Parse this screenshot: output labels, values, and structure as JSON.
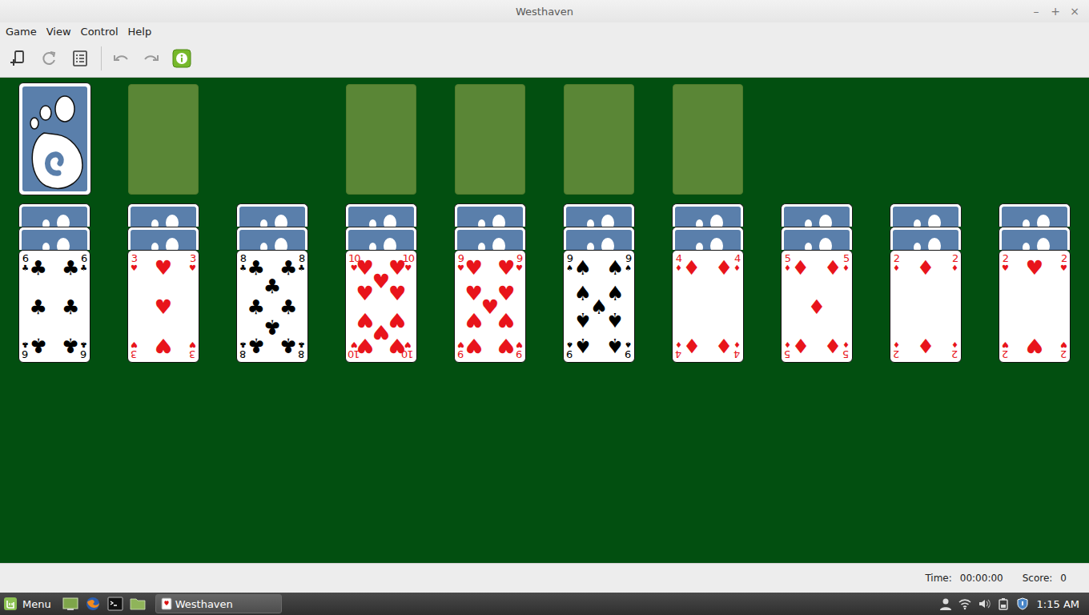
{
  "window": {
    "title": "Westhaven",
    "controls": [
      "–",
      "+",
      "×"
    ]
  },
  "menu": [
    "Game",
    "View",
    "Control",
    "Help"
  ],
  "toolbar": {
    "groups": [
      [
        {
          "kind": "new",
          "disabled": false
        },
        {
          "kind": "restart",
          "disabled": true
        },
        {
          "kind": "stats",
          "disabled": false
        }
      ],
      [
        {
          "kind": "undo",
          "disabled": true
        },
        {
          "kind": "redo",
          "disabled": true
        },
        {
          "kind": "hint",
          "disabled": false
        }
      ]
    ]
  },
  "top_row": [
    {
      "kind": "stock"
    },
    {
      "kind": "slot"
    },
    {
      "kind": "blank"
    },
    {
      "kind": "slot"
    },
    {
      "kind": "slot"
    },
    {
      "kind": "slot"
    },
    {
      "kind": "slot"
    }
  ],
  "tableau": [
    {
      "face_down": 2,
      "card": {
        "rank": "6",
        "suit": "♣",
        "color": "#000000"
      }
    },
    {
      "face_down": 2,
      "card": {
        "rank": "3",
        "suit": "♥",
        "color": "#e8141b"
      }
    },
    {
      "face_down": 2,
      "card": {
        "rank": "8",
        "suit": "♣",
        "color": "#000000"
      }
    },
    {
      "face_down": 2,
      "card": {
        "rank": "10",
        "suit": "♥",
        "color": "#e8141b"
      }
    },
    {
      "face_down": 2,
      "card": {
        "rank": "9",
        "suit": "♥",
        "color": "#e8141b"
      }
    },
    {
      "face_down": 2,
      "card": {
        "rank": "9",
        "suit": "♠",
        "color": "#000000"
      }
    },
    {
      "face_down": 2,
      "card": {
        "rank": "4",
        "suit": "♦",
        "color": "#e8141b"
      }
    },
    {
      "face_down": 2,
      "card": {
        "rank": "5",
        "suit": "♦",
        "color": "#e8141b"
      }
    },
    {
      "face_down": 2,
      "card": {
        "rank": "2",
        "suit": "♦",
        "color": "#e8141b"
      }
    },
    {
      "face_down": 2,
      "card": {
        "rank": "2",
        "suit": "♥",
        "color": "#e8141b"
      }
    }
  ],
  "status_bar": {
    "time_label": "Time:",
    "time": "00:00:00",
    "score_label": "Score:",
    "score": "0"
  },
  "taskbar": {
    "menu": "Menu",
    "launchers": [
      {
        "kind": "desktop"
      },
      {
        "kind": "browser"
      },
      {
        "kind": "terminal"
      },
      {
        "kind": "files"
      }
    ],
    "tasks": [
      {
        "label": "Westhaven",
        "selected": true
      }
    ],
    "tray": [
      {
        "kind": "user"
      },
      {
        "kind": "wifi"
      },
      {
        "kind": "volume"
      },
      {
        "kind": "battery"
      },
      {
        "kind": "shield"
      }
    ],
    "clock": "1:15 AM"
  }
}
